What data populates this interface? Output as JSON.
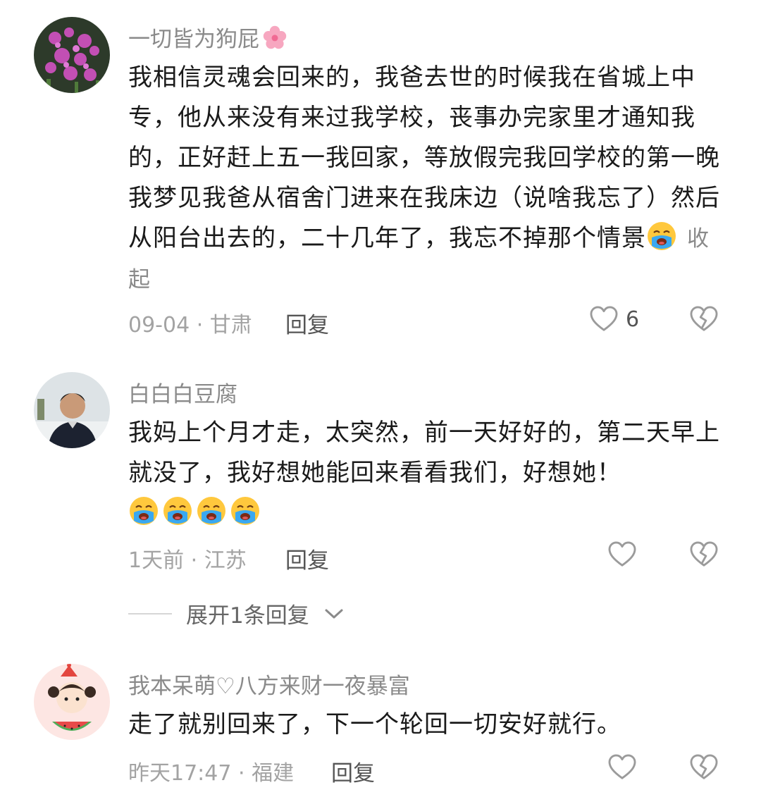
{
  "comments": [
    {
      "author": "一切皆为狗屁",
      "author_emoji": "cherry-blossom",
      "text": "我相信灵魂会回来的，我爸去世的时候我在省城上中专，他从来没有来过我学校，丧事办完家里才通知我的，正好赶上五一我回家，等放假完我回学校的第一晚我梦见我爸从宿舍门进来在我床边（说啥我忘了）然后从阳台出去的，二十几年了，我忘不掉那个情景",
      "trailing_emoji": "loudly-crying-face",
      "collapse_label": "收起",
      "meta": "09-04 · 甘肃",
      "reply_label": "回复",
      "like_count": "6"
    },
    {
      "author": "白白白豆腐",
      "text": "我妈上个月才走，太突然，前一天好好的，第二天早上就没了，我好想她能回来看看我们，好想她！",
      "emoji_count": 4,
      "meta": "1天前 · 江苏",
      "reply_label": "回复",
      "like_count": ""
    },
    {
      "author": "我本呆萌♡八方来财一夜暴富",
      "text": "走了就别回来了，下一个轮回一切安好就行。",
      "meta": "昨天17:47 · 福建",
      "reply_label": "回复",
      "like_count": ""
    }
  ],
  "expand_replies": "展开1条回复",
  "colors": {
    "meta": "#a3a3a3",
    "author": "#8a8a8a",
    "text": "#1a1a1a"
  }
}
